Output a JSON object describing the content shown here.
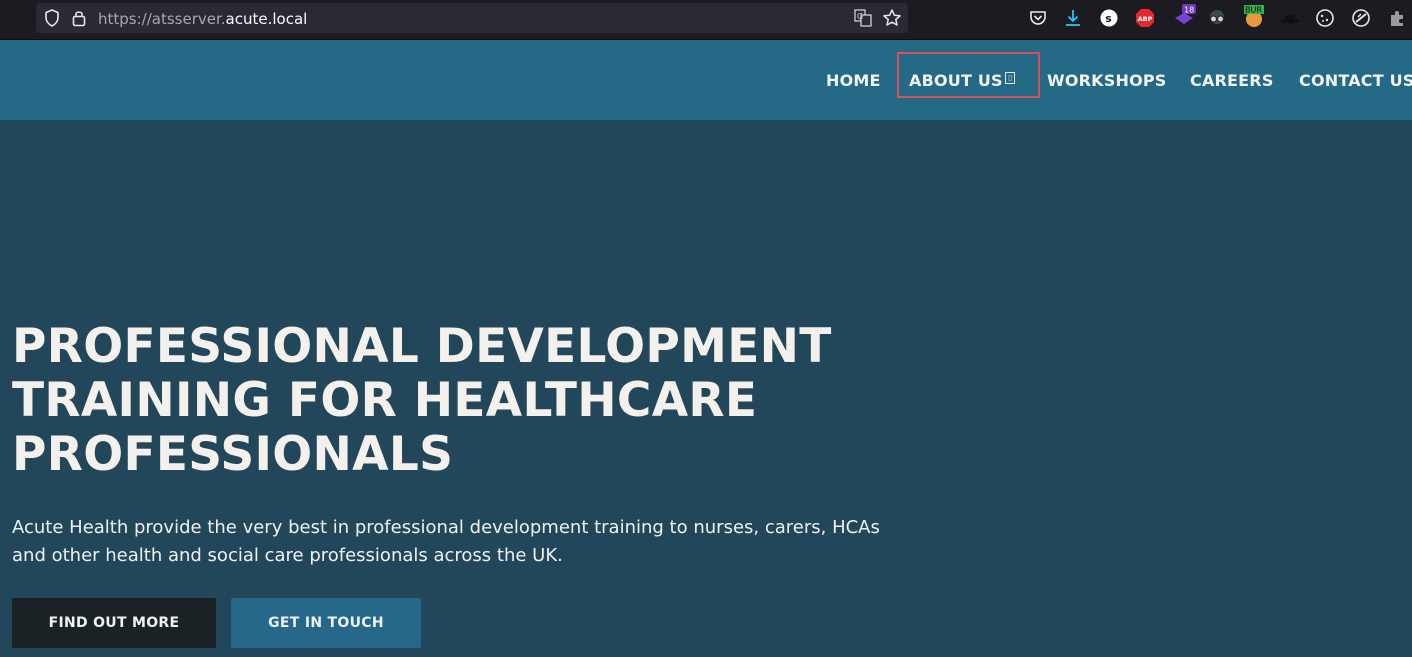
{
  "browser": {
    "url_prefix": "https://atsserver.",
    "url_domain": "acute.local",
    "extensions": [
      {
        "name": "pocket-icon"
      },
      {
        "name": "download-icon",
        "color": "#2ac3f5"
      },
      {
        "name": "s-extension-icon",
        "label": "S"
      },
      {
        "name": "adblock-plus-icon",
        "label": "ABP",
        "color": "#e6282f"
      },
      {
        "name": "extension-badge-icon",
        "badge": "18",
        "color": "#7e3fd3"
      },
      {
        "name": "spy-glasses-icon"
      },
      {
        "name": "burp-icon",
        "badge": "BUR"
      },
      {
        "name": "hat-icon"
      },
      {
        "name": "cookie-icon"
      },
      {
        "name": "compass-icon"
      },
      {
        "name": "puzzle-icon"
      }
    ]
  },
  "nav": {
    "items": [
      "HOME",
      "ABOUT US",
      "WORKSHOPS",
      "CAREERS",
      "CONTACT US"
    ],
    "highlight_color": "#d9505a"
  },
  "hero": {
    "title_lines": [
      "PROFESSIONAL DEVELOPMENT",
      "TRAINING FOR HEALTHCARE",
      "PROFESSIONALS"
    ],
    "subtitle": "Acute Health provide the very best in professional development training to nurses, carers, HCAs and other health and social care professionals across the UK.",
    "primary_button": "FIND OUT MORE",
    "secondary_button": "GET IN TOUCH"
  },
  "colors": {
    "header_bg": "#246a86",
    "hero_bg": "#22475a",
    "dark_button": "#1a2226",
    "blue_button": "#26688a"
  }
}
